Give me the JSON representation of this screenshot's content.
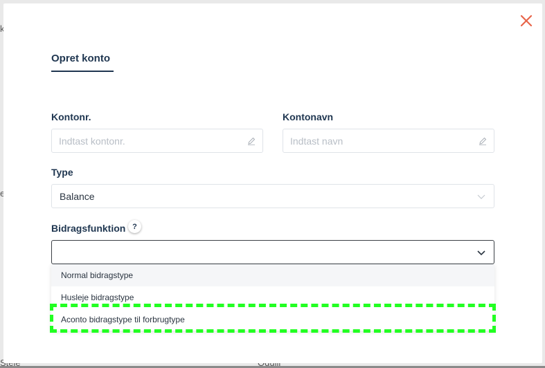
{
  "modal": {
    "tab": "Opret konto",
    "fields": {
      "kontonr_label": "Kontonr.",
      "kontonr_placeholder": "Indtast kontonr.",
      "kontonavn_label": "Kontonavn",
      "kontonavn_placeholder": "Indtast navn",
      "type_label": "Type",
      "type_value": "Balance",
      "bidrag_label": "Bidragsfunktion",
      "bidrag_help": "?",
      "bidrag_value": ""
    },
    "dropdown": {
      "options": [
        "Normal bidragstype",
        "Husleje bidragstype",
        "Aconto bidragstype til forbrugtype"
      ]
    }
  },
  "background": {
    "fragment_1": "k",
    "fragment_2": "e",
    "fragment_3": "Steie",
    "fragment_4": "Oduill"
  },
  "colors": {
    "primary": "#1f3650",
    "close": "#e8654a",
    "highlight": "#22ff22"
  },
  "icons": [
    "close-icon",
    "pencil-icon",
    "chevron-down-icon",
    "help-icon"
  ]
}
